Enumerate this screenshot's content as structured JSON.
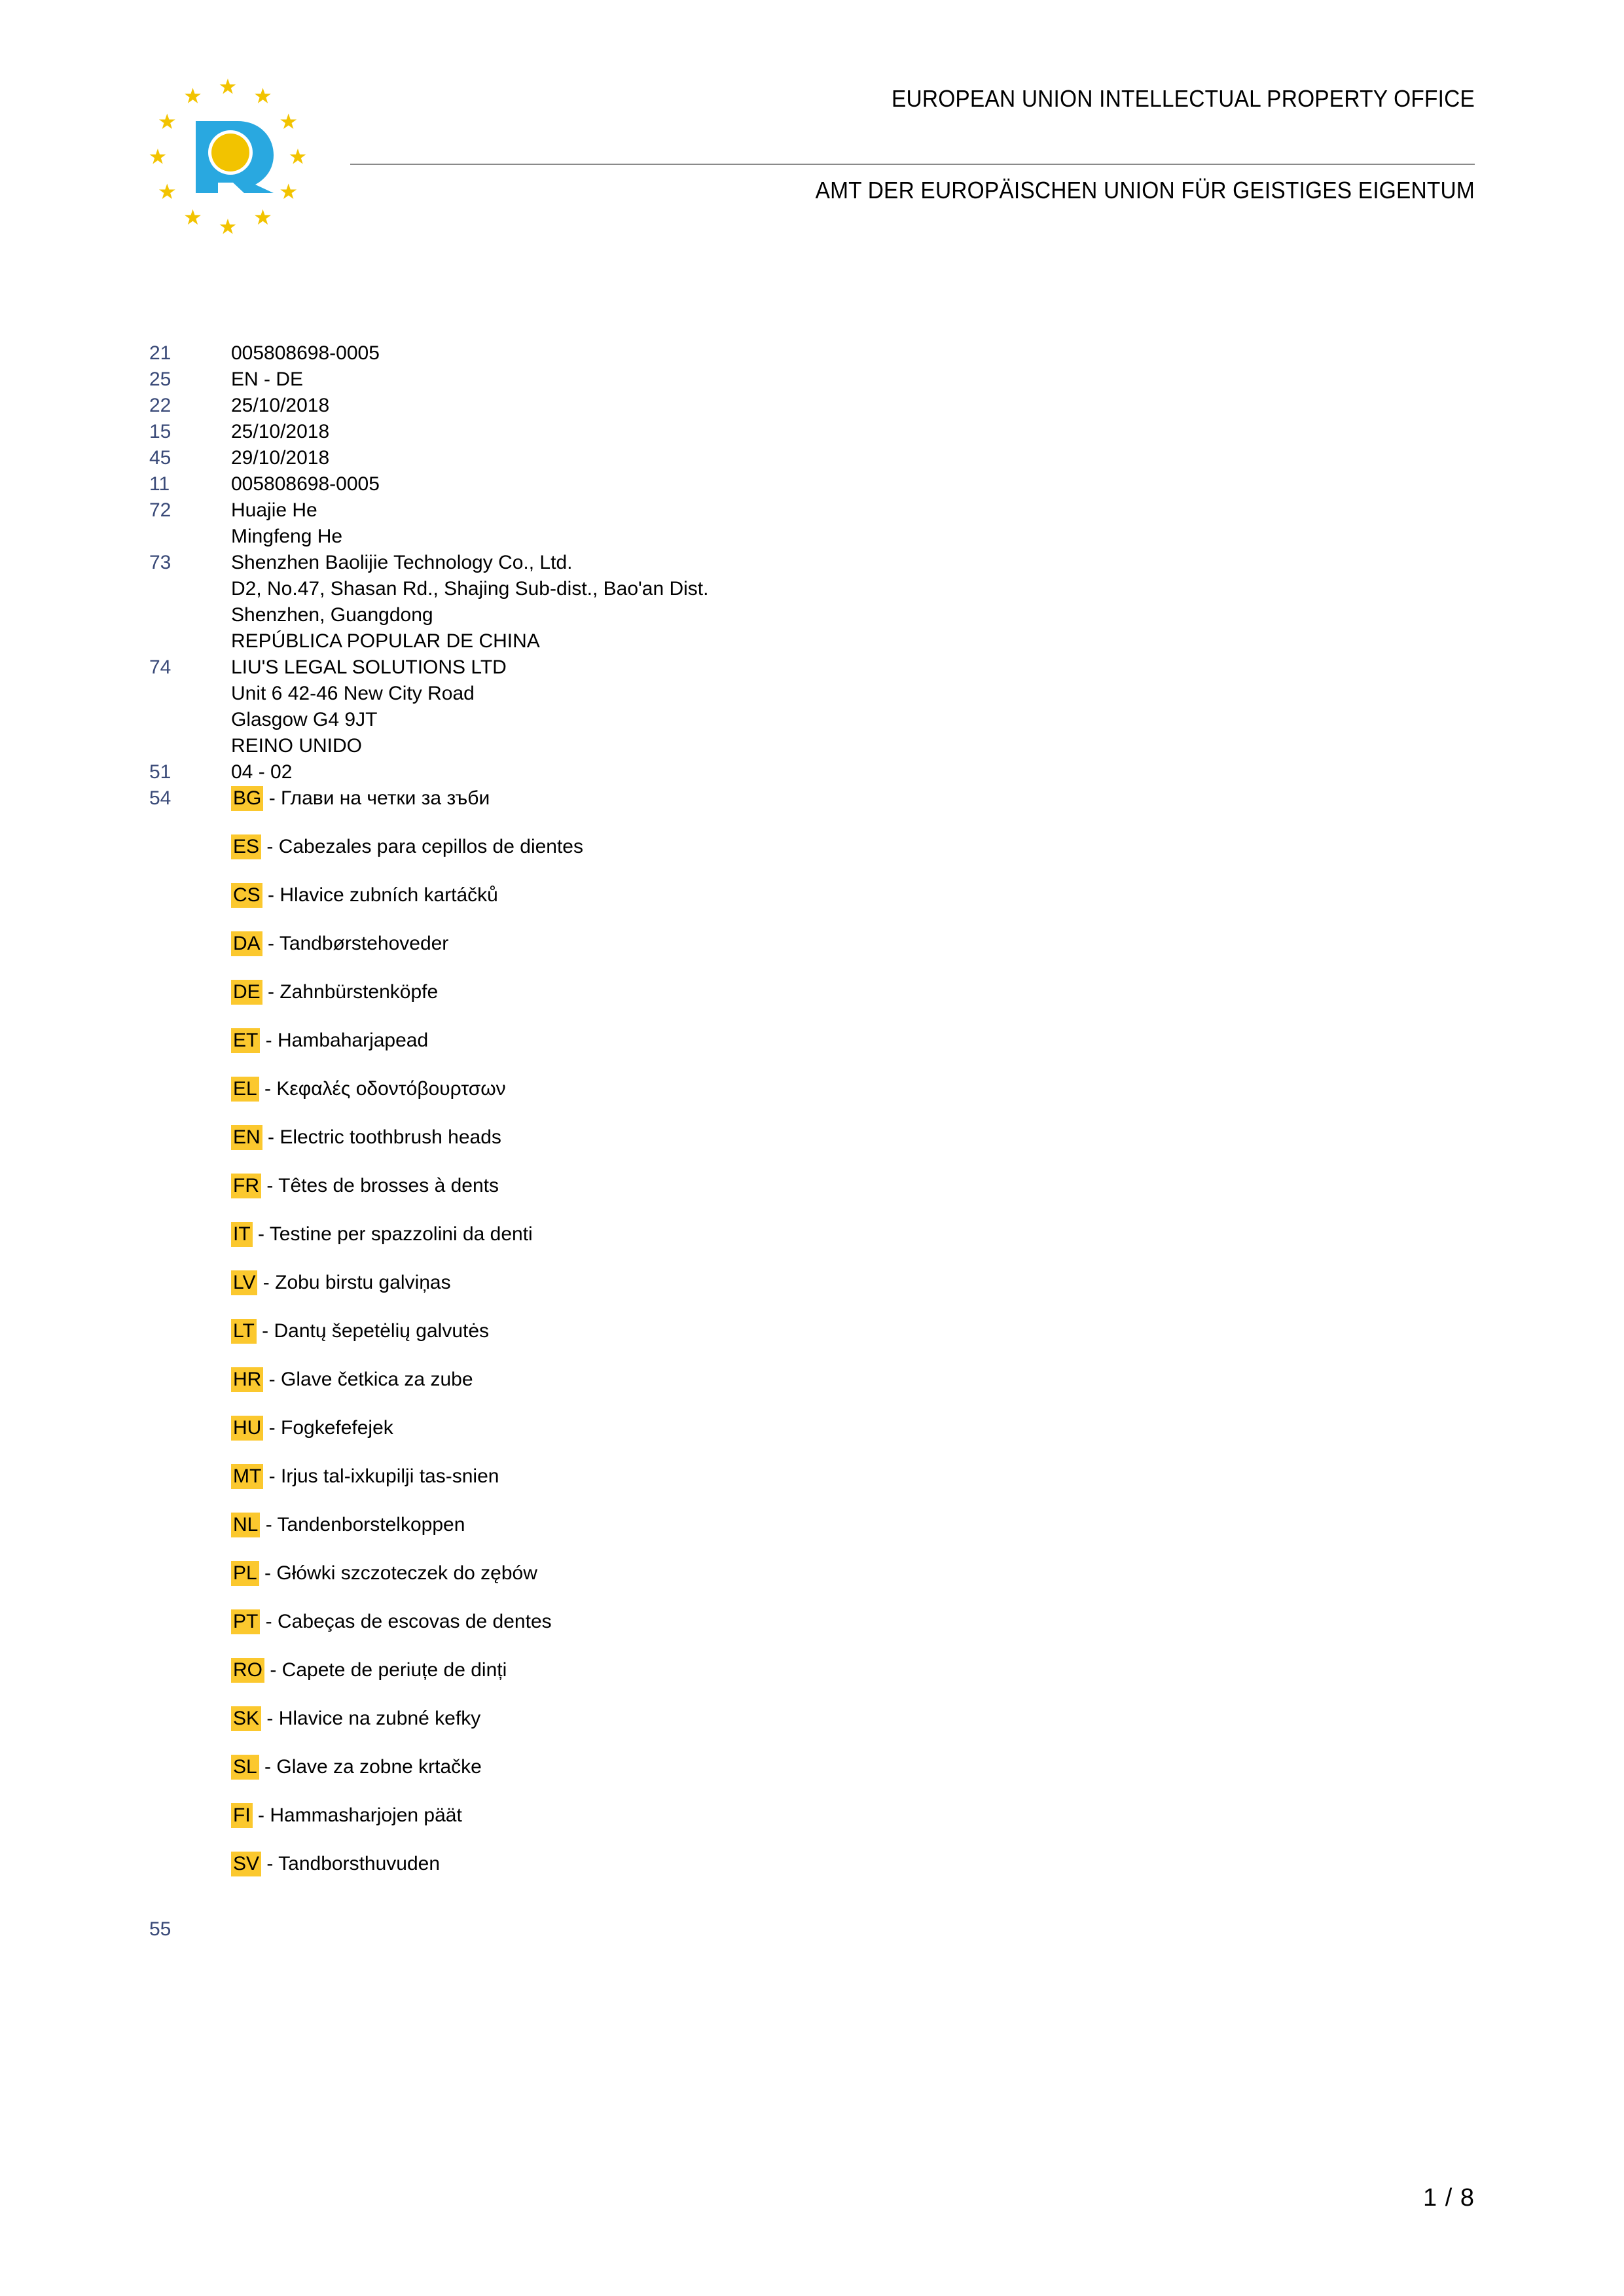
{
  "header": {
    "line_en": "EUROPEAN UNION INTELLECTUAL PROPERTY OFFICE",
    "line_de": "AMT DER EUROPÄISCHEN UNION FÜR GEISTIGES EIGENTUM",
    "logo_name": "euipo-logo",
    "logo_star_color": "#F2C300",
    "logo_letter_color": "#29A8E0",
    "rule_color": "#8a8a8a"
  },
  "colors": {
    "inid_blue": "#3a4a78",
    "highlight_yellow": "#fbc82e",
    "text_black": "#000000"
  },
  "record": {
    "fields": [
      {
        "inid": "21",
        "lines": [
          "005808698-0005"
        ]
      },
      {
        "inid": "25",
        "lines": [
          "EN - DE"
        ]
      },
      {
        "inid": "22",
        "lines": [
          "25/10/2018"
        ]
      },
      {
        "inid": "15",
        "lines": [
          "25/10/2018"
        ]
      },
      {
        "inid": "45",
        "lines": [
          "29/10/2018"
        ]
      },
      {
        "inid": "11",
        "lines": [
          "005808698-0005"
        ]
      },
      {
        "inid": "72",
        "lines": [
          "Huajie He",
          "Mingfeng He"
        ]
      },
      {
        "inid": "73",
        "lines": [
          "Shenzhen Baolijie Technology Co., Ltd.",
          "D2, No.47, Shasan Rd., Shajing Sub-dist., Bao'an Dist.",
          "Shenzhen, Guangdong",
          "REPÚBLICA POPULAR DE CHINA"
        ]
      },
      {
        "inid": "74",
        "lines": [
          "LIU'S LEGAL SOLUTIONS LTD",
          "Unit 6 42-46 New City Road",
          "Glasgow G4 9JT",
          "REINO UNIDO"
        ]
      },
      {
        "inid": "51",
        "lines": [
          "04 - 02"
        ]
      }
    ],
    "indication_inid": "54",
    "indications": [
      {
        "code": "BG",
        "sep": " - ",
        "text": "Глави на четки за зъби"
      },
      {
        "code": "ES",
        "sep": " - ",
        "text": "Cabezales para cepillos de dientes"
      },
      {
        "code": "CS",
        "sep": " - ",
        "text": "Hlavice zubních kartáčků"
      },
      {
        "code": "DA",
        "sep": " - ",
        "text": "Tandbørstehoveder"
      },
      {
        "code": "DE",
        "sep": " - ",
        "text": "Zahnbürstenköpfe"
      },
      {
        "code": "ET",
        "sep": " - ",
        "text": "Hambaharjapead"
      },
      {
        "code": "EL",
        "sep": " - ",
        "text": "Κεφαλές οδοντόβουρτσων"
      },
      {
        "code": "EN",
        "sep": " - ",
        "text": "Electric toothbrush heads"
      },
      {
        "code": "FR",
        "sep": " - ",
        "text": "Têtes de brosses à dents"
      },
      {
        "code": "IT",
        "sep": " - ",
        "text": "Testine per spazzolini da denti"
      },
      {
        "code": "LV",
        "sep": " - ",
        "text": "Zobu birstu galviņas"
      },
      {
        "code": "LT",
        "sep": " - ",
        "text": "Dantų šepetėlių galvutės"
      },
      {
        "code": "HR",
        "sep": " - ",
        "text": "Glave četkica za zube"
      },
      {
        "code": "HU",
        "sep": " - ",
        "text": "Fogkefefejek"
      },
      {
        "code": "MT",
        "sep": " - ",
        "text": "Irjus tal-ixkupilji tas-snien"
      },
      {
        "code": "NL",
        "sep": " - ",
        "text": "Tandenborstelkoppen"
      },
      {
        "code": "PL",
        "sep": " - ",
        "text": "Główki szczoteczek do zębów"
      },
      {
        "code": "PT",
        "sep": " - ",
        "text": "Cabeças de escovas de dentes"
      },
      {
        "code": "RO",
        "sep": " - ",
        "text": "Capete de periuțe de dinți"
      },
      {
        "code": "SK",
        "sep": " - ",
        "text": "Hlavice na zubné kefky"
      },
      {
        "code": "SL",
        "sep": " - ",
        "text": "Glave za zobne krtačke"
      },
      {
        "code": "FI",
        "sep": " - ",
        "text": "Hammasharjojen päät"
      },
      {
        "code": "SV",
        "sep": " - ",
        "text": "Tandborsthuvuden"
      }
    ],
    "trailing_inid": "55"
  },
  "footer": {
    "page_label": "1 / 8"
  }
}
